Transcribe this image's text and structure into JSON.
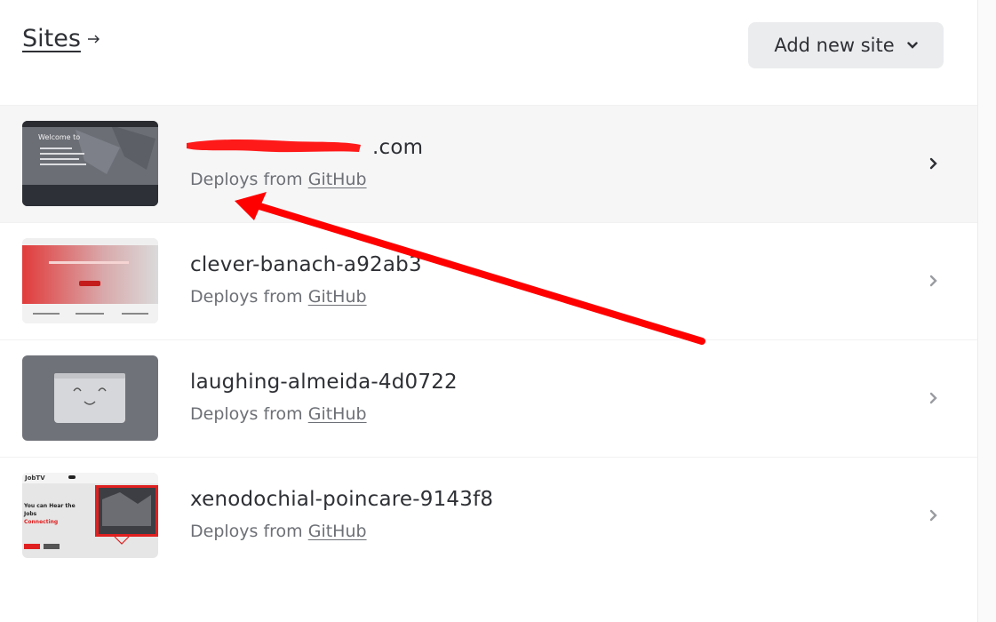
{
  "header": {
    "title": "Sites",
    "add_button_label": "Add new site"
  },
  "sites": [
    {
      "name": ".com",
      "deploy_prefix": "Deploys from",
      "deploy_source": "GitHub"
    },
    {
      "name": "clever-banach-a92ab3",
      "deploy_prefix": "Deploys from",
      "deploy_source": "GitHub"
    },
    {
      "name": "laughing-almeida-4d0722",
      "deploy_prefix": "Deploys from",
      "deploy_source": "GitHub"
    },
    {
      "name": "xenodochial-poincare-9143f8",
      "deploy_prefix": "Deploys from",
      "deploy_source": "GitHub"
    }
  ],
  "thumbs": {
    "t0_heading": "Welcome to",
    "t3_logo": "JobTV",
    "t3_line1": "You can Hear the",
    "t3_line2": "Jobs",
    "t3_line3": "Connecting"
  },
  "colors": {
    "accent_red": "#ff0000",
    "text": "#2e3035",
    "muted": "#6d7076",
    "button_bg": "#ebecee"
  }
}
